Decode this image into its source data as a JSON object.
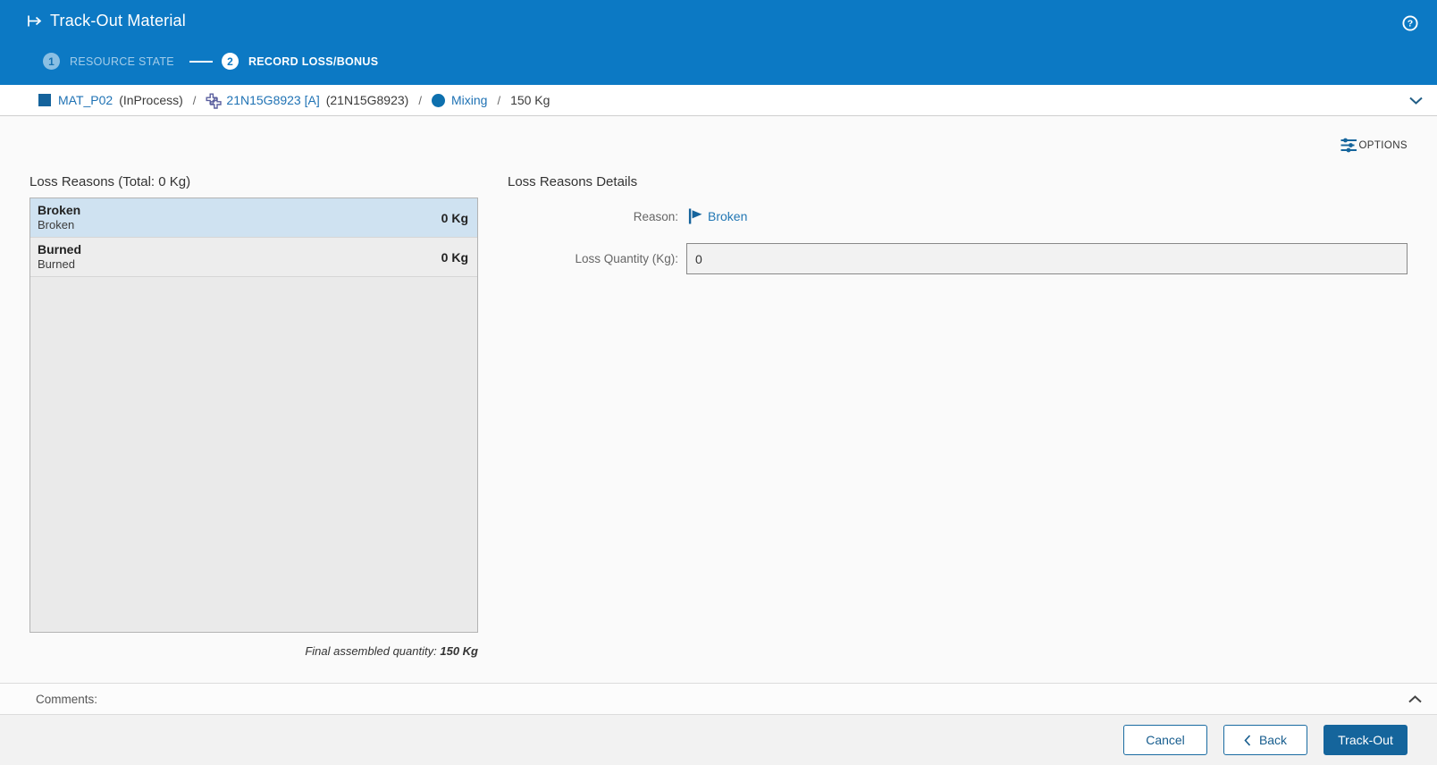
{
  "header": {
    "title": "Track-Out Material",
    "steps": [
      {
        "number": "1",
        "label": "RESOURCE STATE",
        "state": "done"
      },
      {
        "number": "2",
        "label": "RECORD LOSS/BONUS",
        "state": "active"
      }
    ]
  },
  "breadcrumb": {
    "material_name": "MAT_P02",
    "material_state": "(InProcess)",
    "separator": "/",
    "flow_step_name": "21N15G8923 [A]",
    "flow_step_alt": "(21N15G8923)",
    "operation_name": "Mixing",
    "quantity": "150 Kg"
  },
  "toolbar": {
    "options_label": "OPTIONS"
  },
  "loss_reasons": {
    "title": "Loss Reasons (Total: 0 Kg)",
    "items": [
      {
        "name": "Broken",
        "description": "Broken",
        "quantity": "0 Kg",
        "selected": true
      },
      {
        "name": "Burned",
        "description": "Burned",
        "quantity": "0 Kg",
        "selected": false
      }
    ],
    "final_quantity_label": "Final assembled quantity:",
    "final_quantity_value": "150 Kg"
  },
  "details": {
    "title": "Loss Reasons Details",
    "reason_label": "Reason:",
    "reason_value": "Broken",
    "loss_quantity_label": "Loss Quantity (Kg):",
    "loss_quantity_value": "0"
  },
  "comments": {
    "label": "Comments:"
  },
  "footer": {
    "cancel_label": "Cancel",
    "back_label": "Back",
    "trackout_label": "Track-Out"
  },
  "colors": {
    "accent": "#0c79c4",
    "accent_dark": "#15659c",
    "link": "#1f72b4",
    "selected_row": "#cfe2f1"
  }
}
